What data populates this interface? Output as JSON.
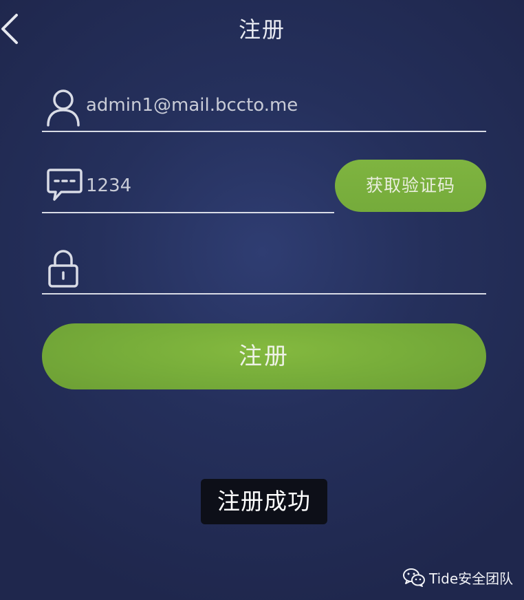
{
  "header": {
    "title": "注册",
    "back_icon": "chevron-left-icon"
  },
  "form": {
    "email": {
      "value": "admin1@mail.bccto.me",
      "icon": "user-icon"
    },
    "code": {
      "value": "1234",
      "icon": "message-icon",
      "get_code_label": "获取验证码"
    },
    "password": {
      "value": "",
      "icon": "lock-icon"
    },
    "submit_label": "注册"
  },
  "toast": {
    "message": "注册成功"
  },
  "watermark": {
    "text": "Tide安全团队",
    "icon": "wechat-icon"
  },
  "colors": {
    "background": "#25305c",
    "accent_green": "#7fb440",
    "toast_bg": "#0d0f18",
    "line": "#d9dce6"
  }
}
